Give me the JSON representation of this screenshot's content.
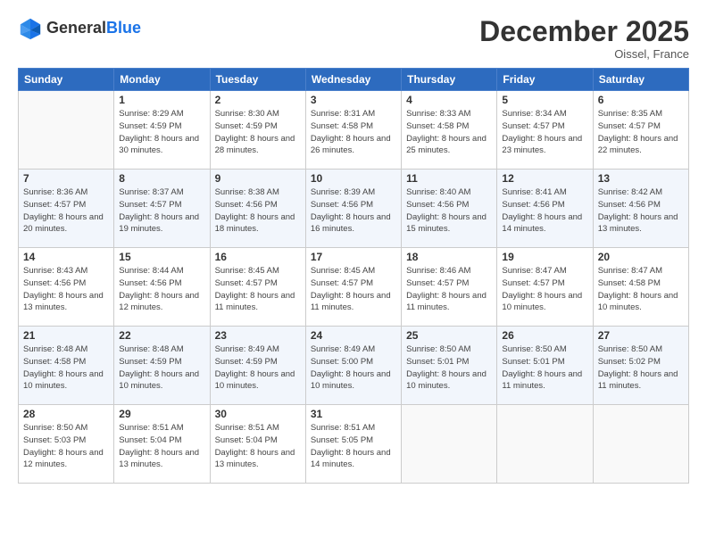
{
  "header": {
    "logo_general": "General",
    "logo_blue": "Blue",
    "month_title": "December 2025",
    "location": "Oissel, France"
  },
  "days_of_week": [
    "Sunday",
    "Monday",
    "Tuesday",
    "Wednesday",
    "Thursday",
    "Friday",
    "Saturday"
  ],
  "weeks": [
    [
      {
        "day": "",
        "sunrise": "",
        "sunset": "",
        "daylight": ""
      },
      {
        "day": "1",
        "sunrise": "Sunrise: 8:29 AM",
        "sunset": "Sunset: 4:59 PM",
        "daylight": "Daylight: 8 hours and 30 minutes."
      },
      {
        "day": "2",
        "sunrise": "Sunrise: 8:30 AM",
        "sunset": "Sunset: 4:59 PM",
        "daylight": "Daylight: 8 hours and 28 minutes."
      },
      {
        "day": "3",
        "sunrise": "Sunrise: 8:31 AM",
        "sunset": "Sunset: 4:58 PM",
        "daylight": "Daylight: 8 hours and 26 minutes."
      },
      {
        "day": "4",
        "sunrise": "Sunrise: 8:33 AM",
        "sunset": "Sunset: 4:58 PM",
        "daylight": "Daylight: 8 hours and 25 minutes."
      },
      {
        "day": "5",
        "sunrise": "Sunrise: 8:34 AM",
        "sunset": "Sunset: 4:57 PM",
        "daylight": "Daylight: 8 hours and 23 minutes."
      },
      {
        "day": "6",
        "sunrise": "Sunrise: 8:35 AM",
        "sunset": "Sunset: 4:57 PM",
        "daylight": "Daylight: 8 hours and 22 minutes."
      }
    ],
    [
      {
        "day": "7",
        "sunrise": "Sunrise: 8:36 AM",
        "sunset": "Sunset: 4:57 PM",
        "daylight": "Daylight: 8 hours and 20 minutes."
      },
      {
        "day": "8",
        "sunrise": "Sunrise: 8:37 AM",
        "sunset": "Sunset: 4:57 PM",
        "daylight": "Daylight: 8 hours and 19 minutes."
      },
      {
        "day": "9",
        "sunrise": "Sunrise: 8:38 AM",
        "sunset": "Sunset: 4:56 PM",
        "daylight": "Daylight: 8 hours and 18 minutes."
      },
      {
        "day": "10",
        "sunrise": "Sunrise: 8:39 AM",
        "sunset": "Sunset: 4:56 PM",
        "daylight": "Daylight: 8 hours and 16 minutes."
      },
      {
        "day": "11",
        "sunrise": "Sunrise: 8:40 AM",
        "sunset": "Sunset: 4:56 PM",
        "daylight": "Daylight: 8 hours and 15 minutes."
      },
      {
        "day": "12",
        "sunrise": "Sunrise: 8:41 AM",
        "sunset": "Sunset: 4:56 PM",
        "daylight": "Daylight: 8 hours and 14 minutes."
      },
      {
        "day": "13",
        "sunrise": "Sunrise: 8:42 AM",
        "sunset": "Sunset: 4:56 PM",
        "daylight": "Daylight: 8 hours and 13 minutes."
      }
    ],
    [
      {
        "day": "14",
        "sunrise": "Sunrise: 8:43 AM",
        "sunset": "Sunset: 4:56 PM",
        "daylight": "Daylight: 8 hours and 13 minutes."
      },
      {
        "day": "15",
        "sunrise": "Sunrise: 8:44 AM",
        "sunset": "Sunset: 4:56 PM",
        "daylight": "Daylight: 8 hours and 12 minutes."
      },
      {
        "day": "16",
        "sunrise": "Sunrise: 8:45 AM",
        "sunset": "Sunset: 4:57 PM",
        "daylight": "Daylight: 8 hours and 11 minutes."
      },
      {
        "day": "17",
        "sunrise": "Sunrise: 8:45 AM",
        "sunset": "Sunset: 4:57 PM",
        "daylight": "Daylight: 8 hours and 11 minutes."
      },
      {
        "day": "18",
        "sunrise": "Sunrise: 8:46 AM",
        "sunset": "Sunset: 4:57 PM",
        "daylight": "Daylight: 8 hours and 11 minutes."
      },
      {
        "day": "19",
        "sunrise": "Sunrise: 8:47 AM",
        "sunset": "Sunset: 4:57 PM",
        "daylight": "Daylight: 8 hours and 10 minutes."
      },
      {
        "day": "20",
        "sunrise": "Sunrise: 8:47 AM",
        "sunset": "Sunset: 4:58 PM",
        "daylight": "Daylight: 8 hours and 10 minutes."
      }
    ],
    [
      {
        "day": "21",
        "sunrise": "Sunrise: 8:48 AM",
        "sunset": "Sunset: 4:58 PM",
        "daylight": "Daylight: 8 hours and 10 minutes."
      },
      {
        "day": "22",
        "sunrise": "Sunrise: 8:48 AM",
        "sunset": "Sunset: 4:59 PM",
        "daylight": "Daylight: 8 hours and 10 minutes."
      },
      {
        "day": "23",
        "sunrise": "Sunrise: 8:49 AM",
        "sunset": "Sunset: 4:59 PM",
        "daylight": "Daylight: 8 hours and 10 minutes."
      },
      {
        "day": "24",
        "sunrise": "Sunrise: 8:49 AM",
        "sunset": "Sunset: 5:00 PM",
        "daylight": "Daylight: 8 hours and 10 minutes."
      },
      {
        "day": "25",
        "sunrise": "Sunrise: 8:50 AM",
        "sunset": "Sunset: 5:01 PM",
        "daylight": "Daylight: 8 hours and 10 minutes."
      },
      {
        "day": "26",
        "sunrise": "Sunrise: 8:50 AM",
        "sunset": "Sunset: 5:01 PM",
        "daylight": "Daylight: 8 hours and 11 minutes."
      },
      {
        "day": "27",
        "sunrise": "Sunrise: 8:50 AM",
        "sunset": "Sunset: 5:02 PM",
        "daylight": "Daylight: 8 hours and 11 minutes."
      }
    ],
    [
      {
        "day": "28",
        "sunrise": "Sunrise: 8:50 AM",
        "sunset": "Sunset: 5:03 PM",
        "daylight": "Daylight: 8 hours and 12 minutes."
      },
      {
        "day": "29",
        "sunrise": "Sunrise: 8:51 AM",
        "sunset": "Sunset: 5:04 PM",
        "daylight": "Daylight: 8 hours and 13 minutes."
      },
      {
        "day": "30",
        "sunrise": "Sunrise: 8:51 AM",
        "sunset": "Sunset: 5:04 PM",
        "daylight": "Daylight: 8 hours and 13 minutes."
      },
      {
        "day": "31",
        "sunrise": "Sunrise: 8:51 AM",
        "sunset": "Sunset: 5:05 PM",
        "daylight": "Daylight: 8 hours and 14 minutes."
      },
      {
        "day": "",
        "sunrise": "",
        "sunset": "",
        "daylight": ""
      },
      {
        "day": "",
        "sunrise": "",
        "sunset": "",
        "daylight": ""
      },
      {
        "day": "",
        "sunrise": "",
        "sunset": "",
        "daylight": ""
      }
    ]
  ]
}
